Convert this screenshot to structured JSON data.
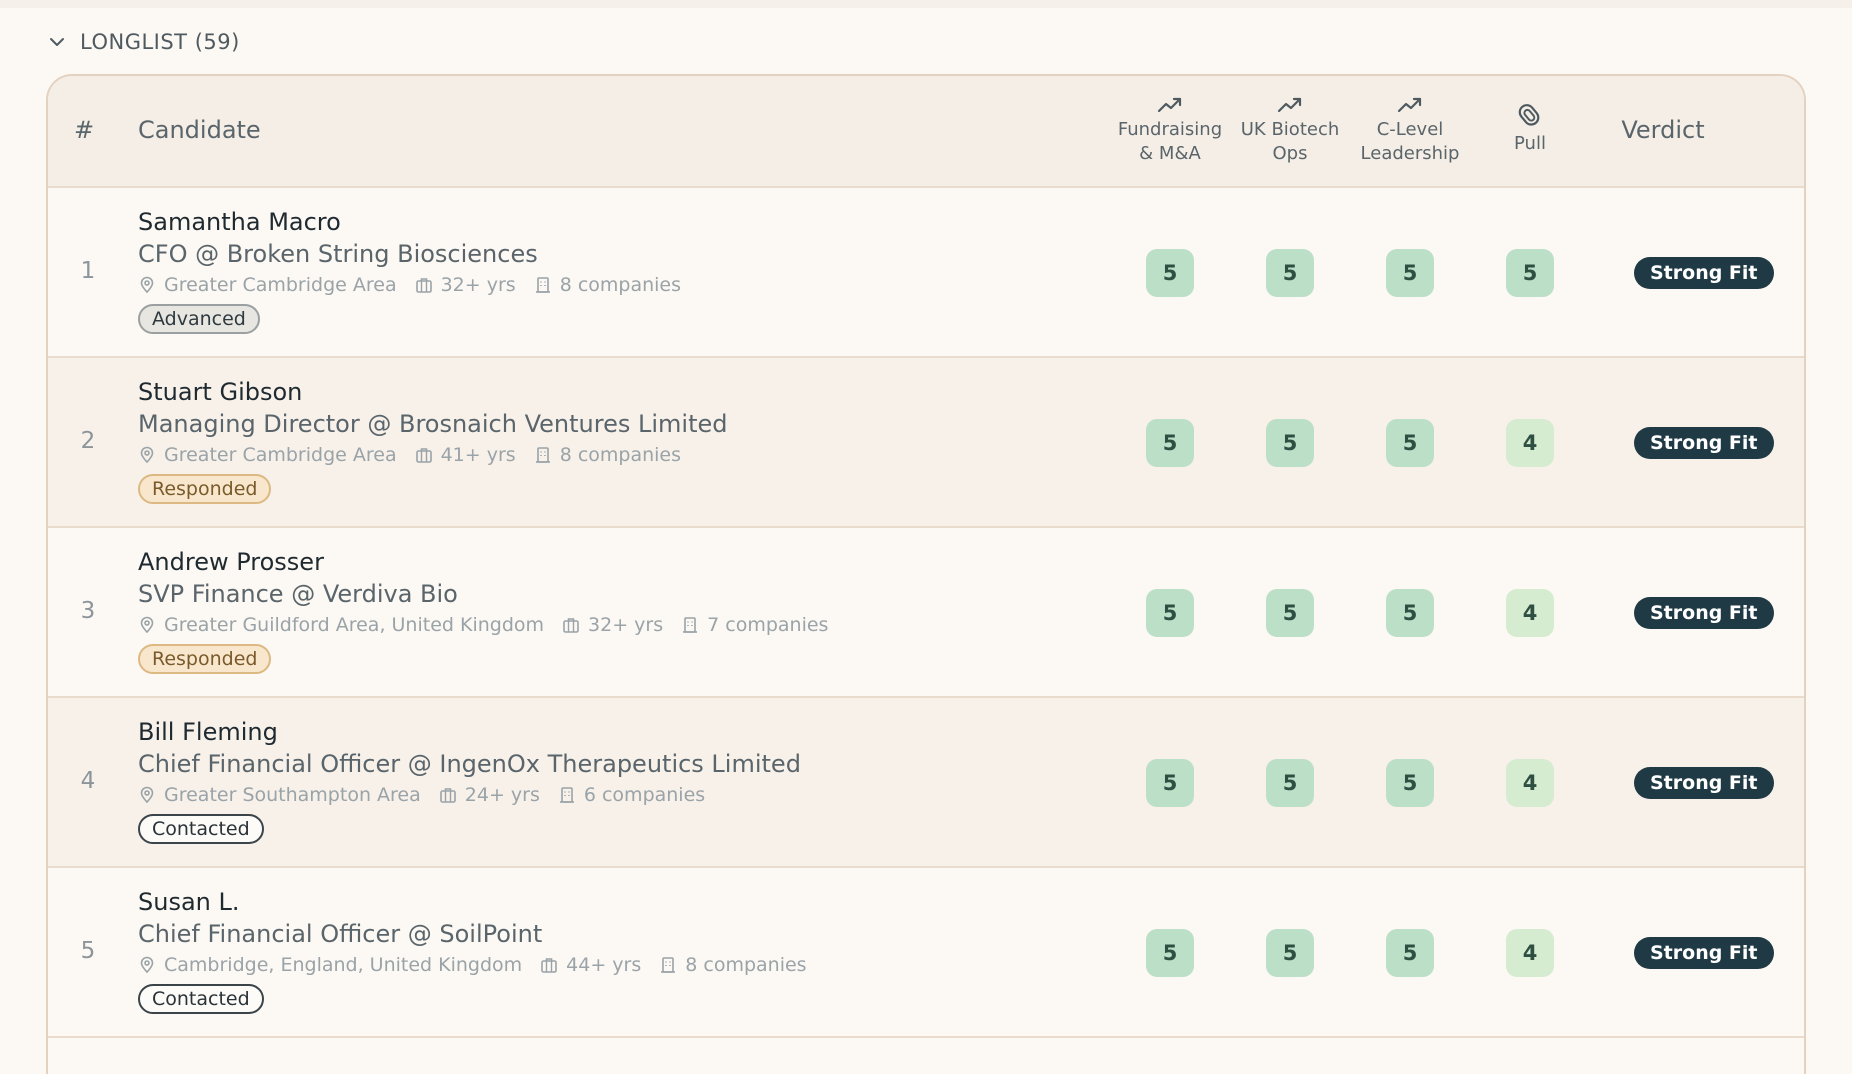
{
  "section": {
    "title": "LONGLIST (59)",
    "chevron_icon": "chevron-down-icon"
  },
  "table": {
    "headers": {
      "number": "#",
      "candidate": "Candidate",
      "scores": [
        {
          "line1": "Fundraising",
          "line2": "& M&A",
          "icon": "trending-up-icon"
        },
        {
          "line1": "UK Biotech",
          "line2": "Ops",
          "icon": "trending-up-icon"
        },
        {
          "line1": "C-Level",
          "line2": "Leadership",
          "icon": "trending-up-icon"
        },
        {
          "line1": "Pull",
          "line2": "",
          "icon": "magnet-icon"
        }
      ],
      "verdict": "Verdict"
    },
    "rows": [
      {
        "num": "1",
        "name": "Samantha Macro",
        "title": "CFO @ Broken String Biosciences",
        "location": "Greater Cambridge Area",
        "years": "32+ yrs",
        "companies": "8 companies",
        "status": "Advanced",
        "status_kind": "advanced",
        "scores": [
          "5",
          "5",
          "5",
          "5"
        ],
        "verdict": "Strong Fit"
      },
      {
        "num": "2",
        "name": "Stuart Gibson",
        "title": "Managing Director @ Brosnaich Ventures Limited",
        "location": "Greater Cambridge Area",
        "years": "41+ yrs",
        "companies": "8 companies",
        "status": "Responded",
        "status_kind": "responded",
        "scores": [
          "5",
          "5",
          "5",
          "4"
        ],
        "verdict": "Strong Fit"
      },
      {
        "num": "3",
        "name": "Andrew Prosser",
        "title": "SVP Finance @ Verdiva Bio",
        "location": "Greater Guildford Area, United Kingdom",
        "years": "32+ yrs",
        "companies": "7 companies",
        "status": "Responded",
        "status_kind": "responded",
        "scores": [
          "5",
          "5",
          "5",
          "4"
        ],
        "verdict": "Strong Fit"
      },
      {
        "num": "4",
        "name": "Bill Fleming",
        "title": "Chief Financial Officer @ IngenOx Therapeutics Limited",
        "location": "Greater Southampton Area",
        "years": "24+ yrs",
        "companies": "6 companies",
        "status": "Contacted",
        "status_kind": "contacted",
        "scores": [
          "5",
          "5",
          "5",
          "4"
        ],
        "verdict": "Strong Fit"
      },
      {
        "num": "5",
        "name": "Susan L.",
        "title": "Chief Financial Officer @ SoilPoint",
        "location": "Cambridge, England, United Kingdom",
        "years": "44+ yrs",
        "companies": "8 companies",
        "status": "Contacted",
        "status_kind": "contacted",
        "scores": [
          "5",
          "5",
          "5",
          "4"
        ],
        "verdict": "Strong Fit"
      }
    ]
  },
  "colors": {
    "background": "#fcf8f3",
    "header_bg": "#f5eee6",
    "score_5": "#bcdfc8",
    "score_4": "#d5ecd0",
    "verdict_bg": "#1f3a44"
  }
}
